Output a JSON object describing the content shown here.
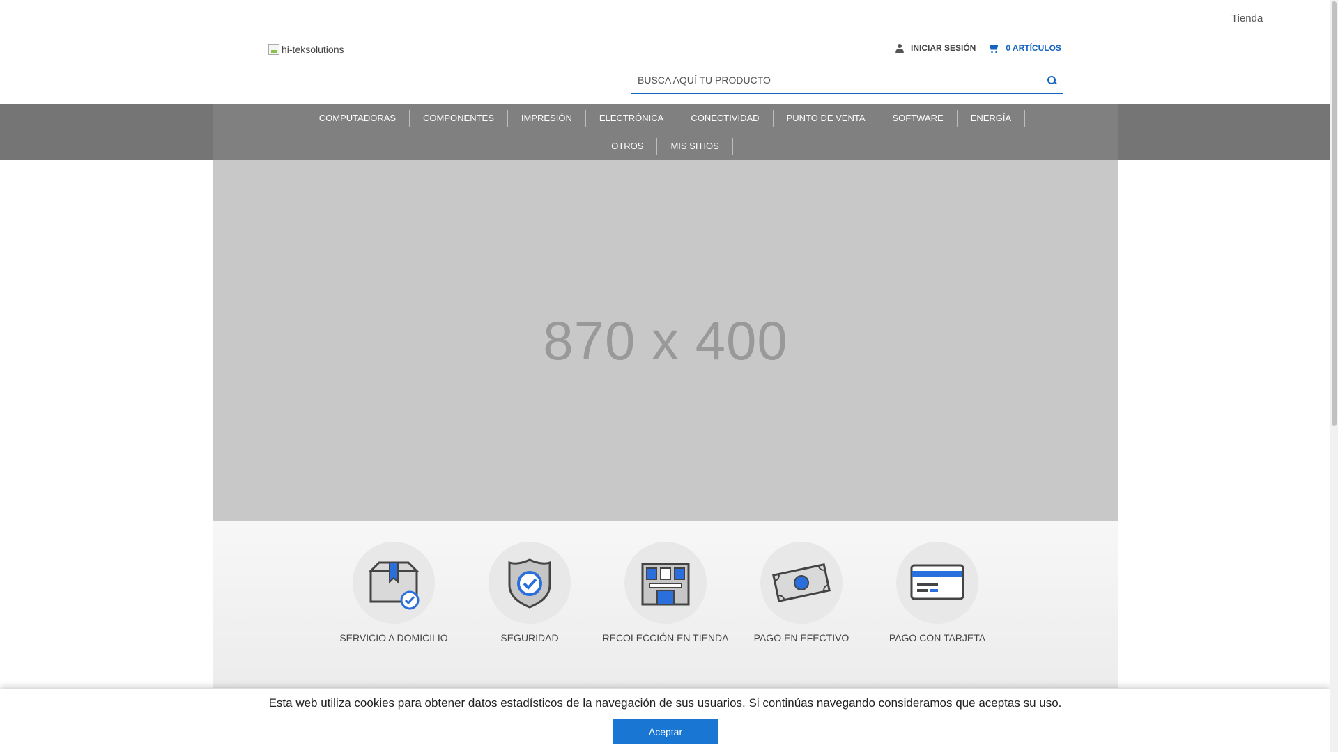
{
  "top_link": "Tienda",
  "logo_alt": "hi-teksolutions",
  "account": {
    "login_label": "INICIAR SESIÓN",
    "cart_label": "0 ARTÍCULOS"
  },
  "search": {
    "placeholder": "BUSCA AQUÍ TU PRODUCTO"
  },
  "nav": {
    "row1": [
      "COMPUTADORAS",
      "COMPONENTES",
      "IMPRESIÓN",
      "ELECTRÓNICA",
      "CONECTIVIDAD",
      "PUNTO DE VENTA",
      "SOFTWARE",
      "ENERGÍA"
    ],
    "row2": [
      "OTROS",
      "MIS SITIOS"
    ]
  },
  "banner_text": "870 x 400",
  "features": [
    {
      "label": "SERVICIO A DOMICILIO",
      "icon": "box-check-icon"
    },
    {
      "label": "SEGURIDAD",
      "icon": "shield-check-icon"
    },
    {
      "label": "RECOLECCIÓN EN TIENDA",
      "icon": "store-icon"
    },
    {
      "label": "PAGO EN EFECTIVO",
      "icon": "cash-icon"
    },
    {
      "label": "PAGO CON TARJETA",
      "icon": "credit-card-icon"
    }
  ],
  "cookie": {
    "message": "Esta web utiliza cookies para obtener datos estadísticos de la navegación de sus usuarios. Si continúas navegando consideramos que aceptas su uso.",
    "accept_label": "Aceptar"
  },
  "colors": {
    "accent": "#1565c0",
    "nav_bg": "#757575",
    "banner_bg": "#c8c8c8",
    "button_bg": "#1976d2"
  }
}
